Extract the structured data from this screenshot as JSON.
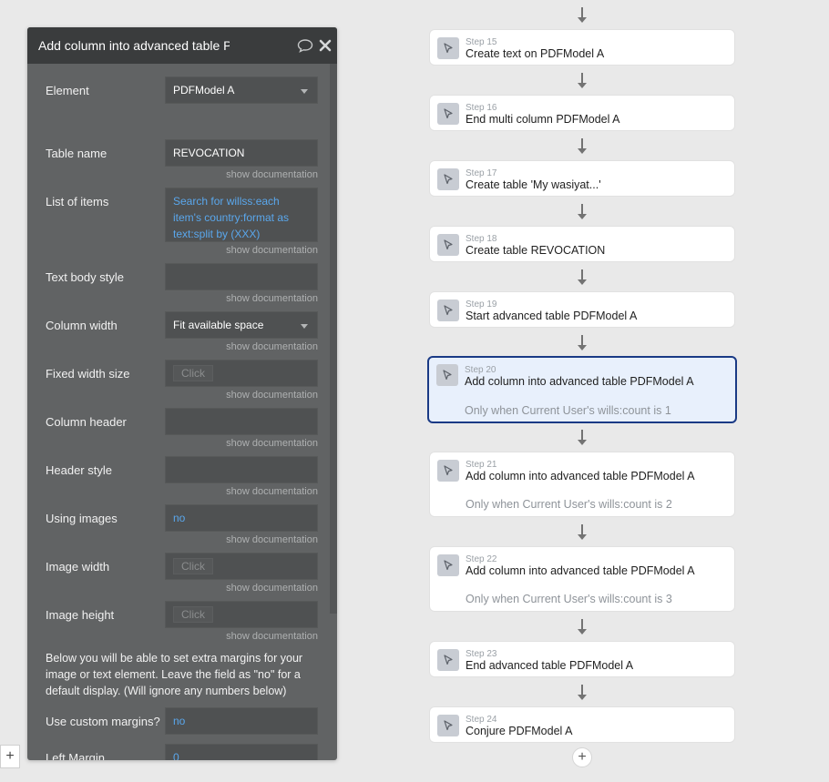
{
  "panel": {
    "title": "Add column into advanced table PDFModel A",
    "doc_label": "show documentation",
    "click_label": "Click",
    "properties": {
      "element": {
        "label": "Element",
        "value": "PDFModel A"
      },
      "table_name": {
        "label": "Table name",
        "value": "REVOCATION"
      },
      "list_of_items": {
        "label": "List of items",
        "value": "Search for willss:each item's country:format as text:split by (XXX)"
      },
      "text_body_style": {
        "label": "Text body style",
        "value": ""
      },
      "column_width": {
        "label": "Column width",
        "value": "Fit available space"
      },
      "fixed_width_size": {
        "label": "Fixed width size"
      },
      "column_header": {
        "label": "Column header",
        "value": ""
      },
      "header_style": {
        "label": "Header style",
        "value": ""
      },
      "using_images": {
        "label": "Using images",
        "value": "no"
      },
      "image_width": {
        "label": "Image width"
      },
      "image_height": {
        "label": "Image height"
      },
      "margins_info": "Below you will be able to set extra margins for your image or text element. Leave the field as \"no\" for a default display. (Will ignore any numbers below)",
      "use_custom_margins": {
        "label": "Use custom margins?",
        "value": "no"
      },
      "left_margin": {
        "label": "Left Margin",
        "value": "0"
      }
    }
  },
  "workflow": {
    "steps": [
      {
        "num": "Step 15",
        "title": "Create text on PDFModel A"
      },
      {
        "num": "Step 16",
        "title": "End multi column PDFModel A"
      },
      {
        "num": "Step 17",
        "title": "Create table 'My wasiyat...'"
      },
      {
        "num": "Step 18",
        "title": "Create table REVOCATION"
      },
      {
        "num": "Step 19",
        "title": "Start advanced table PDFModel A"
      },
      {
        "num": "Step 20",
        "title": "Add column into advanced table PDFModel A",
        "condition": "Only when Current User's wills:count is 1",
        "selected": true
      },
      {
        "num": "Step 21",
        "title": "Add column into advanced table PDFModel A",
        "condition": "Only when Current User's wills:count is 2"
      },
      {
        "num": "Step 22",
        "title": "Add column into advanced table PDFModel A",
        "condition": "Only when Current User's wills:count is 3"
      },
      {
        "num": "Step 23",
        "title": "End advanced table PDFModel A"
      },
      {
        "num": "Step 24",
        "title": "Conjure PDFModel A"
      }
    ],
    "add_step_symbol": "+"
  },
  "canvas": {
    "add_symbol": "+"
  },
  "colors": {
    "panel_bg": "#616364",
    "header_bg": "#3a3c3d",
    "link": "#5aa7ec",
    "selected_border": "#1a3a85",
    "selected_bg": "#e8f0fc"
  },
  "icons": {
    "comment": "comment-icon",
    "close": "close-icon",
    "step": "cursor-icon"
  }
}
